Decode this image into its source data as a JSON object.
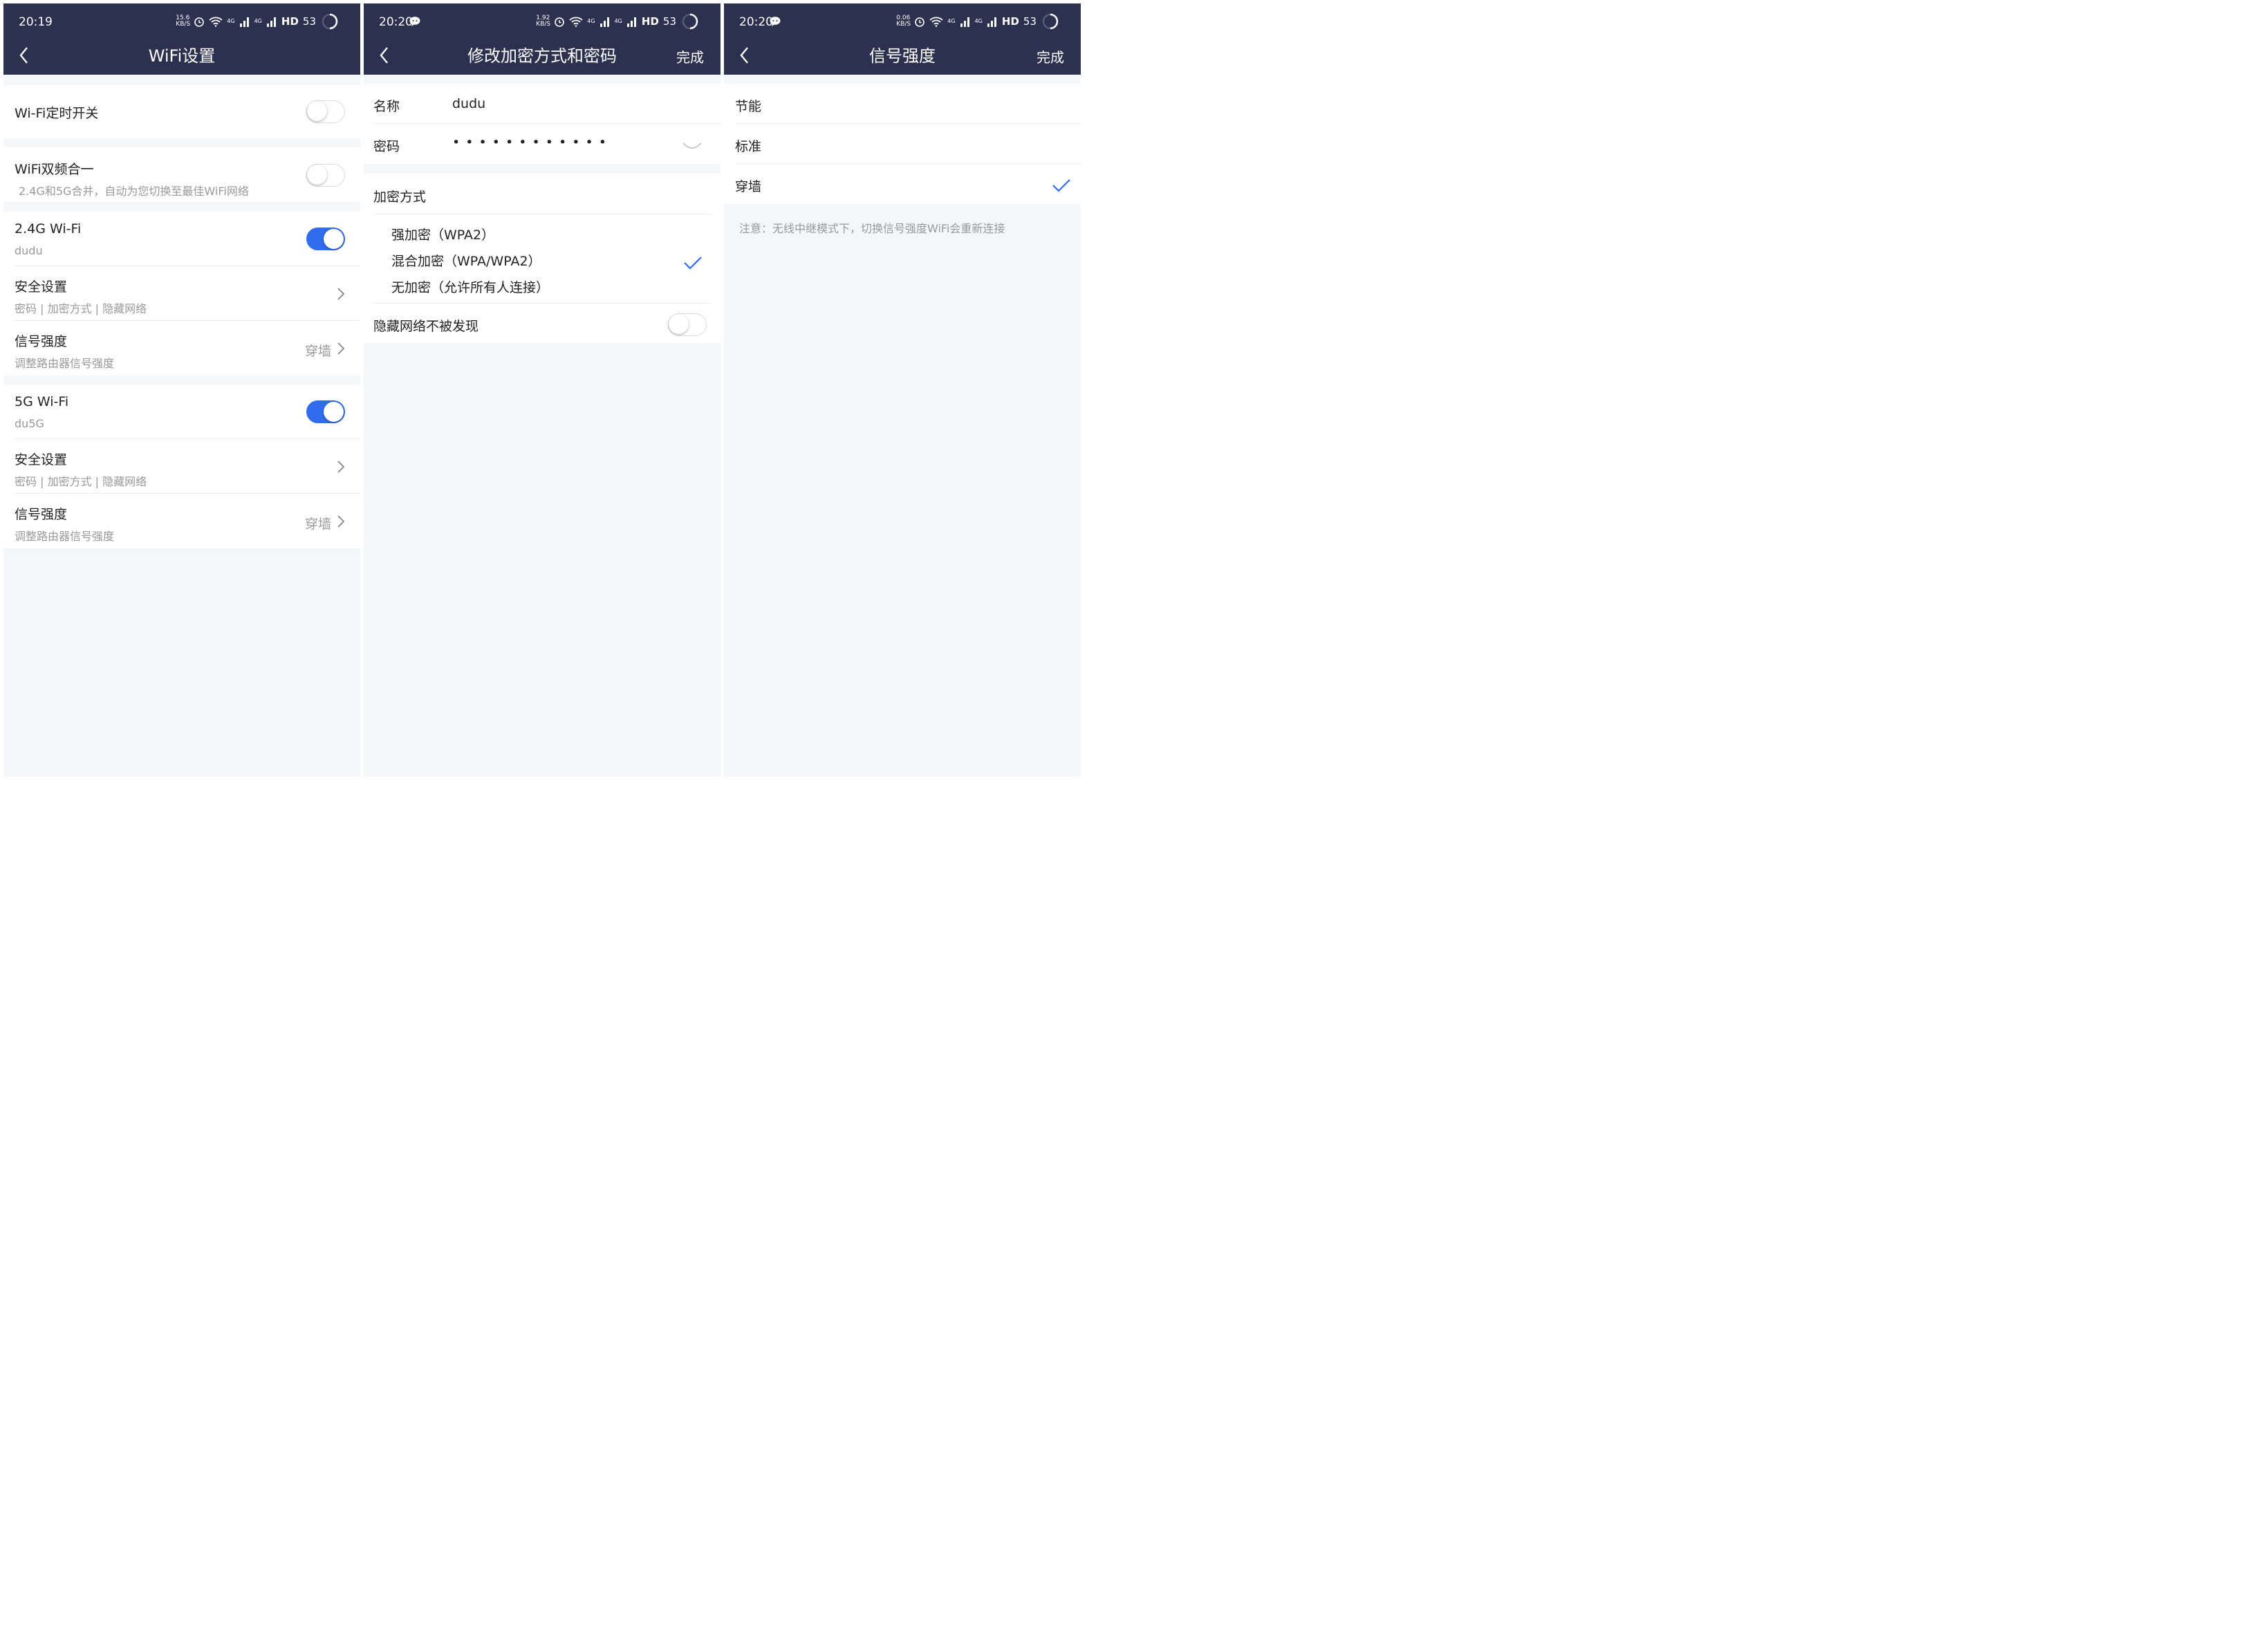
{
  "screens": [
    {
      "status": {
        "time": "20:19",
        "speed_value": "15.6",
        "speed_unit": "KB/S",
        "net1": "4G",
        "net2": "4G",
        "hd": "HD",
        "battery": "53"
      },
      "nav": {
        "title": "WiFi设置",
        "back_icon": "chevron-left-icon"
      },
      "rows": {
        "timer": {
          "title": "Wi-Fi定时开关",
          "toggle": "off"
        },
        "dual": {
          "title": "WiFi双频合一",
          "subtitle": "2.4G和5G合并，自动为您切换至最佳WiFi网络",
          "toggle": "off"
        },
        "wifi24": {
          "title": "2.4G Wi-Fi",
          "ssid": "dudu",
          "toggle": "on"
        },
        "sec24": {
          "title": "安全设置",
          "subtitle": "密码 | 加密方式 | 隐藏网络"
        },
        "sig24": {
          "title": "信号强度",
          "subtitle": "调整路由器信号强度",
          "value": "穿墙"
        },
        "wifi5": {
          "title": "5G Wi-Fi",
          "ssid": "du5G",
          "toggle": "on"
        },
        "sec5": {
          "title": "安全设置",
          "subtitle": "密码 | 加密方式 | 隐藏网络"
        },
        "sig5": {
          "title": "信号强度",
          "subtitle": "调整路由器信号强度",
          "value": "穿墙"
        }
      }
    },
    {
      "status": {
        "time": "20:20",
        "speed_value": "1.92",
        "speed_unit": "KB/S",
        "net1": "4G",
        "net2": "4G",
        "hd": "HD",
        "battery": "53"
      },
      "nav": {
        "title": "修改加密方式和密码",
        "done": "完成",
        "back_icon": "chevron-left-icon"
      },
      "name_label": "名称",
      "name_value": "dudu",
      "password_label": "密码",
      "password_value": "• • • • • • • • • • • •",
      "encryption_header": "加密方式",
      "options": [
        "强加密（WPA2）",
        "混合加密（WPA/WPA2）",
        "无加密（允许所有人连接）"
      ],
      "selected_option": 1,
      "hide_label": "隐藏网络不被发现",
      "hide_toggle": "off"
    },
    {
      "status": {
        "time": "20:20",
        "speed_value": "0.06",
        "speed_unit": "KB/S",
        "net1": "4G",
        "net2": "4G",
        "hd": "HD",
        "battery": "53"
      },
      "nav": {
        "title": "信号强度",
        "done": "完成",
        "back_icon": "chevron-left-icon"
      },
      "options": [
        "节能",
        "标准",
        "穿墙"
      ],
      "selected_option": 2,
      "note": "注意：无线中继模式下，切换信号强度WiFi会重新连接"
    }
  ],
  "colors": {
    "header": "#2d3150",
    "accent": "#2f6cf0",
    "background": "#f5f6f8",
    "secondary_text": "#999999"
  }
}
